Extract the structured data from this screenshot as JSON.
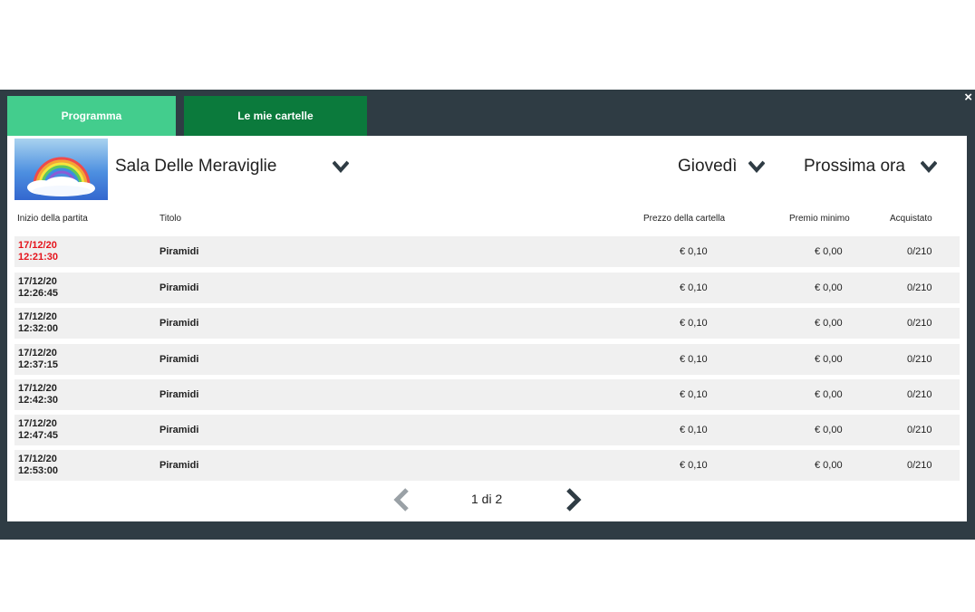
{
  "tabs": {
    "programma": "Programma",
    "le_mie_cartelle": "Le mie cartelle"
  },
  "close_label": "×",
  "room": {
    "name": "Sala Delle Meraviglie",
    "image": "rainbow-cloud-thumbnail"
  },
  "filters": {
    "day": "Giovedì",
    "hour": "Prossima ora"
  },
  "columns": {
    "start": "Inizio della partita",
    "title": "Titolo",
    "price": "Prezzo della cartella",
    "prize": "Premio minimo",
    "bought": "Acquistato"
  },
  "rows": [
    {
      "date": "17/12/20",
      "time": "12:21:30",
      "title": "Piramidi",
      "price": "€ 0,10",
      "prize": "€ 0,00",
      "bought": "0/210",
      "highlight": true
    },
    {
      "date": "17/12/20",
      "time": "12:26:45",
      "title": "Piramidi",
      "price": "€ 0,10",
      "prize": "€ 0,00",
      "bought": "0/210"
    },
    {
      "date": "17/12/20",
      "time": "12:32:00",
      "title": "Piramidi",
      "price": "€ 0,10",
      "prize": "€ 0,00",
      "bought": "0/210"
    },
    {
      "date": "17/12/20",
      "time": "12:37:15",
      "title": "Piramidi",
      "price": "€ 0,10",
      "prize": "€ 0,00",
      "bought": "0/210"
    },
    {
      "date": "17/12/20",
      "time": "12:42:30",
      "title": "Piramidi",
      "price": "€ 0,10",
      "prize": "€ 0,00",
      "bought": "0/210"
    },
    {
      "date": "17/12/20",
      "time": "12:47:45",
      "title": "Piramidi",
      "price": "€ 0,10",
      "prize": "€ 0,00",
      "bought": "0/210"
    },
    {
      "date": "17/12/20",
      "time": "12:53:00",
      "title": "Piramidi",
      "price": "€ 0,10",
      "prize": "€ 0,00",
      "bought": "0/210"
    }
  ],
  "pagination": {
    "text": "1 di 2",
    "prev_enabled": false,
    "next_enabled": true
  },
  "colors": {
    "frame": "#2f3c44",
    "tab_active": "#43cd8d",
    "tab_inactive": "#0b7a3c",
    "row_bg": "#f0f0f0",
    "highlight_text": "#e5141c",
    "pager_disabled": "#9aa1a6",
    "pager_enabled": "#2f3c44"
  }
}
